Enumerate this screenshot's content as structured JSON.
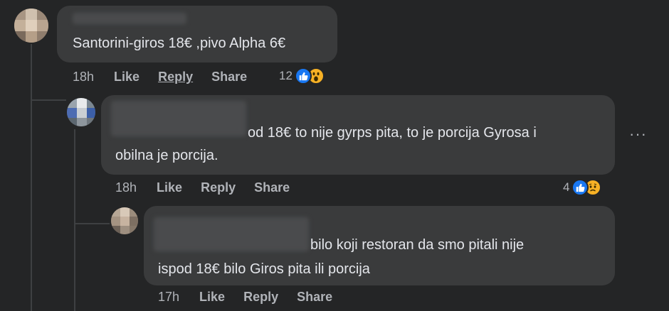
{
  "comments": [
    {
      "text_lines": [
        "Santorini-giros 18€ ,pivo Alpha 6€"
      ],
      "time": "18h",
      "like": "Like",
      "reply": "Reply",
      "share": "Share",
      "reaction_count": "12",
      "reactions": [
        "like-icon",
        "wow-icon"
      ]
    },
    {
      "text_lines": [
        "od 18€ to nije gyrps pita, to je porcija Gyrosa i",
        "obilna je porcija."
      ],
      "time": "18h",
      "like": "Like",
      "reply": "Reply",
      "share": "Share",
      "reaction_count": "4",
      "reactions": [
        "like-icon",
        "sad-icon"
      ],
      "more": "···"
    },
    {
      "text_lines": [
        "bilo koji restoran da smo pitali nije",
        "ispod 18€ bilo Giros pita ili porcija"
      ],
      "time": "17h",
      "like": "Like",
      "reply": "Reply",
      "share": "Share"
    }
  ],
  "colors": {
    "background": "#242526",
    "bubble": "#3a3b3c",
    "text": "#e4e6eb",
    "secondary_text": "#b0b3b8",
    "like_blue": "#1877f2",
    "emoji_yellow": "#f7b125"
  }
}
